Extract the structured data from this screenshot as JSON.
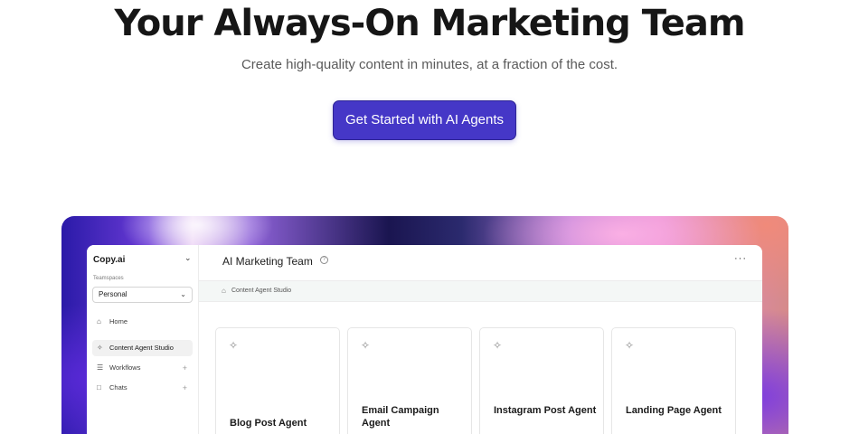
{
  "hero": {
    "title": "Your Always-On Marketing Team",
    "subtitle": "Create high-quality content in minutes, at a fraction of the cost.",
    "cta_label": "Get Started with AI Agents"
  },
  "app": {
    "brand": "Copy.ai",
    "teamspaces_label": "Teamspaces",
    "teamspace_selected": "Personal",
    "nav": [
      {
        "label": "Home",
        "icon": "home-icon"
      },
      {
        "label": "Content Agent Studio",
        "icon": "sparkle-icon",
        "active": true
      },
      {
        "label": "Workflows",
        "icon": "workflow-icon"
      },
      {
        "label": "Chats",
        "icon": "chat-icon"
      }
    ],
    "main_title": "AI Marketing Team",
    "breadcrumb": "Content Agent Studio",
    "cards": [
      {
        "title": "Blog Post Agent"
      },
      {
        "title": "Email Campaign Agent"
      },
      {
        "title": "Instagram Post Agent"
      },
      {
        "title": "Landing Page Agent"
      }
    ]
  },
  "colors": {
    "accent": "#4537c7",
    "text": "#161616",
    "muted": "#5a5a5a"
  }
}
